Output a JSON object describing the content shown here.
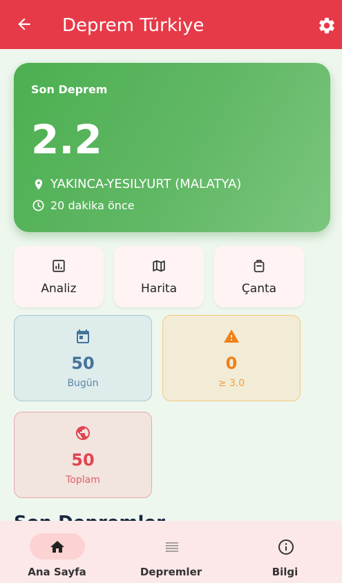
{
  "appbar": {
    "title": "Deprem Türkiye",
    "bg": "#e73a48"
  },
  "latest": {
    "label": "Son Deprem",
    "magnitude": "2.2",
    "location": "YAKINCA-YESILYURT (MALATYA)",
    "time": "20 dakika önce",
    "color": "#4caf50"
  },
  "quick_actions": [
    {
      "label": "Analiz",
      "icon": "analytics-icon"
    },
    {
      "label": "Harita",
      "icon": "map-icon"
    },
    {
      "label": "Çanta",
      "icon": "bag-icon"
    }
  ],
  "stats": [
    {
      "value": "50",
      "label": "Bugün",
      "icon": "calendar-icon",
      "color": "#44739a"
    },
    {
      "value": "0",
      "label": "≥ 3.0",
      "icon": "warning-icon",
      "color": "#f08018"
    },
    {
      "value": "50",
      "label": "Toplam",
      "icon": "globe-icon",
      "color": "#e04550"
    }
  ],
  "section_title": "Son Depremler",
  "bottom_nav": [
    {
      "label": "Ana Sayfa",
      "icon": "home-icon",
      "active": true
    },
    {
      "label": "Depremler",
      "icon": "list-icon",
      "active": false
    },
    {
      "label": "Bilgi",
      "icon": "info-icon",
      "active": false
    }
  ]
}
